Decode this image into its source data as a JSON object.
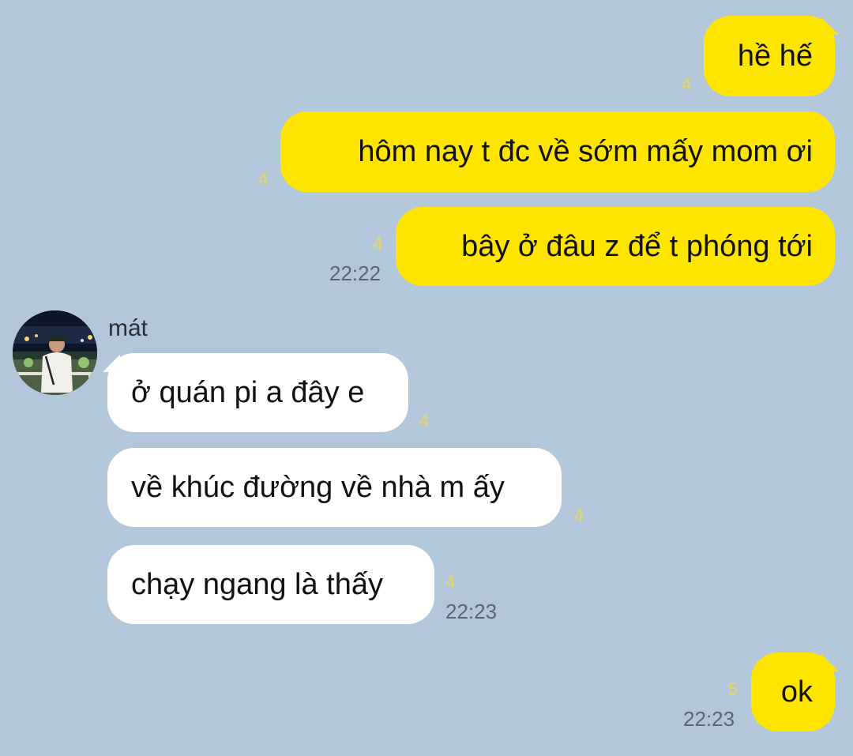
{
  "messages": [
    {
      "side": "out",
      "text": "hề hế",
      "unread": "4"
    },
    {
      "side": "out",
      "text": "hôm nay t đc về sớm mấy mom ơi",
      "unread": "4"
    },
    {
      "side": "out",
      "text": "bây ở đâu z để t phóng tới",
      "unread": "4",
      "time": "22:22"
    },
    {
      "side": "in",
      "text": "ở quán pi a đây e",
      "unread": "4"
    },
    {
      "side": "in",
      "text": "về khúc đường về nhà m ấy",
      "unread": "4"
    },
    {
      "side": "in",
      "text": "chạy ngang là thấy",
      "unread": "4",
      "time": "22:23"
    },
    {
      "side": "out",
      "text": "ok",
      "unread": "5",
      "time": "22:23"
    }
  ],
  "contact": {
    "name": "mát",
    "avatar_icon": "profile-photo"
  },
  "colors": {
    "background": "#b2c7d9",
    "outgoing_bubble": "#fee500",
    "incoming_bubble": "#ffffff",
    "unread_count": "#e8d84a",
    "timestamp": "#5a6672"
  }
}
